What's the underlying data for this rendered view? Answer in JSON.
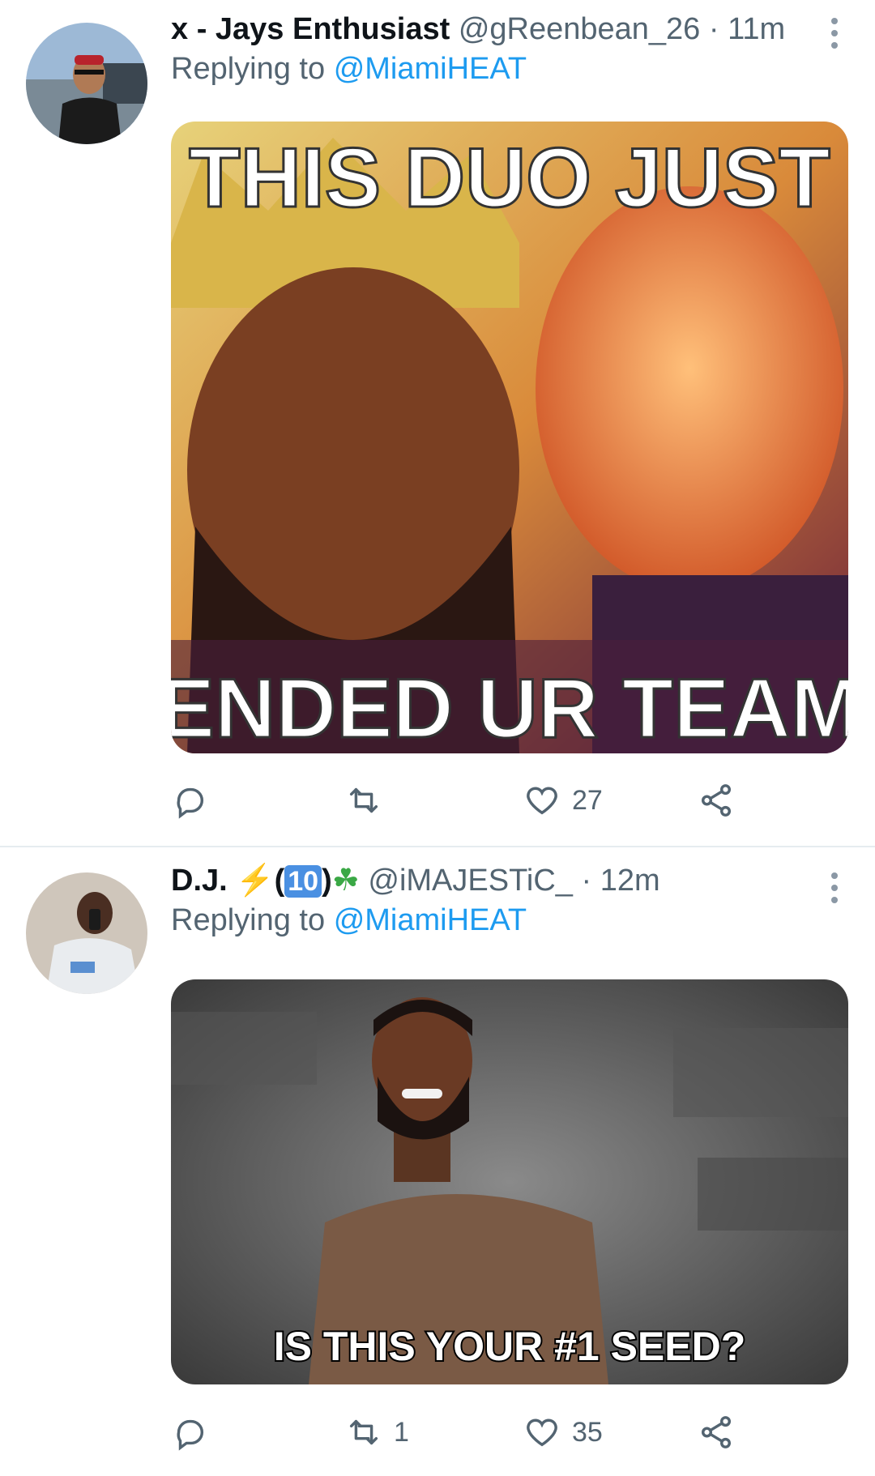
{
  "tweets": [
    {
      "display_name": "x - Jays Enthusiast",
      "handle": "@gReenbean_26",
      "separator": "·",
      "time": "11m",
      "replying_prefix": "Replying to",
      "replying_to": "@MiamiHEAT",
      "media_text_top": "THIS DUO JUST",
      "media_text_bottom": "ENDED UR TEAM",
      "counts": {
        "reply": "",
        "retweet": "",
        "like": "27"
      }
    },
    {
      "display_name": "D.J.",
      "name_emoji_bolt": "⚡",
      "name_emoji_open": "(",
      "name_emoji_number": "10",
      "name_emoji_close": ")",
      "name_emoji_clover": "☘",
      "handle": "@iMAJESTiC_",
      "separator": "·",
      "time": "12m",
      "replying_prefix": "Replying to",
      "replying_to": "@MiamiHEAT",
      "media_caption": "IS THIS YOUR #1 SEED?",
      "counts": {
        "reply": "",
        "retweet": "1",
        "like": "35"
      }
    }
  ],
  "icons": {
    "reply": "reply-icon",
    "retweet": "retweet-icon",
    "like": "heart-icon",
    "share": "share-icon",
    "more": "more-vertical-icon"
  },
  "colors": {
    "link": "#1d9bf0",
    "secondary_text": "#536471",
    "divider": "#e6ecf0"
  }
}
